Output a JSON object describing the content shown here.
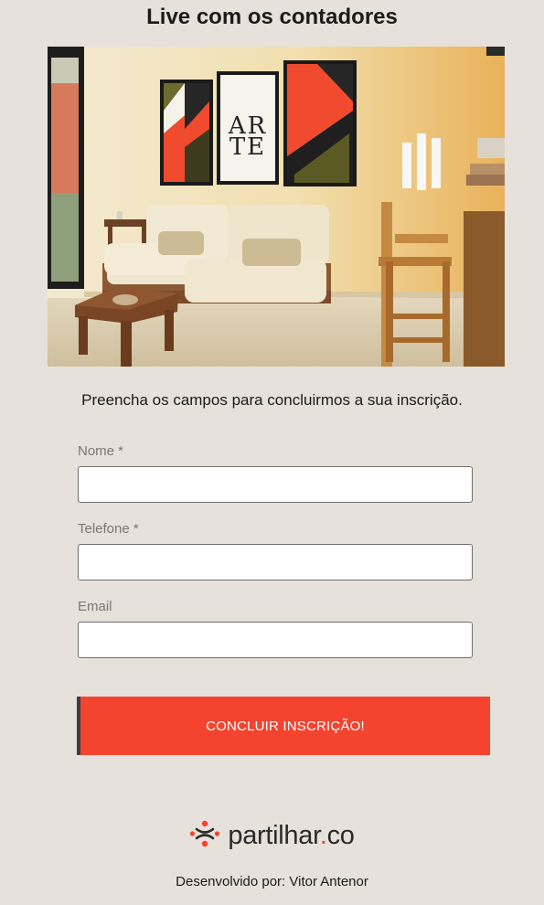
{
  "page": {
    "title": "Live com os contadores",
    "subtitle": "Preencha os campos para concluirmos a sua inscrição."
  },
  "form": {
    "name_label": "Nome *",
    "name_value": "",
    "phone_label": "Telefone *",
    "phone_value": "",
    "email_label": "Email",
    "email_value": "",
    "submit_label": "CONCLUIR INSCRIÇÃO!"
  },
  "hero": {
    "artwork_letters": "ARTE",
    "icon": "living-room-photo"
  },
  "brand": {
    "name_main": "partilhar",
    "name_dot": ".",
    "name_tld": "co",
    "icon": "partilhar-logo-icon"
  },
  "footer": {
    "credit": "Desenvolvido por: Vitor Antenor"
  },
  "colors": {
    "background": "#e6e1da",
    "accent": "#f4432f",
    "button_border": "#3a3f4a",
    "text": "#1b1b1b"
  }
}
